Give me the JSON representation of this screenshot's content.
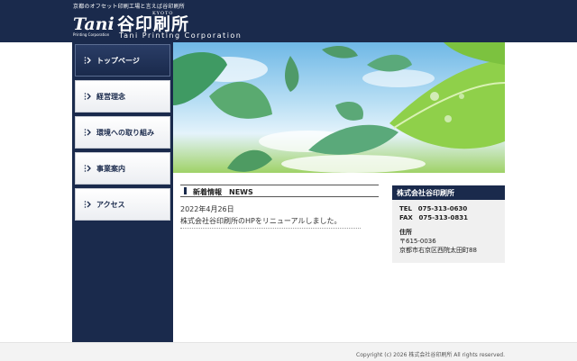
{
  "header": {
    "tagline": "京都のオフセット印刷工場と言えば谷印刷所",
    "logo": {
      "kyoto": "KYOTO",
      "mark": "Tani",
      "sub": "Printing Corporation"
    },
    "company_jp": "谷印刷所",
    "company_en": "Tani Printing Corporation"
  },
  "nav": {
    "items": [
      {
        "label": "トップページ",
        "active": true
      },
      {
        "label": "経営理念"
      },
      {
        "label": "環境への取り組み"
      },
      {
        "label": "事業案内"
      },
      {
        "label": "アクセス"
      }
    ]
  },
  "news": {
    "title": "新着情報　NEWS",
    "date": "2022年4月26日",
    "text": "株式会社谷印刷所のHPをリニューアルしました。"
  },
  "company_info": {
    "title": "株式会社谷印刷所",
    "tel_label": "TEL",
    "tel": "075-313-0630",
    "fax_label": "FAX",
    "fax": "075-313-0831",
    "address_label": "住所",
    "postal": "〒615-0036",
    "address": "京都市右京区西院太田町88"
  },
  "footer": {
    "copyright": "Copyright (c) 2026 株式会社谷印刷所 All rights reserved."
  },
  "colors": {
    "navy": "#1a2a4c",
    "hero_sky": "#6fb8e6",
    "hero_leaf": "#9fd267"
  }
}
